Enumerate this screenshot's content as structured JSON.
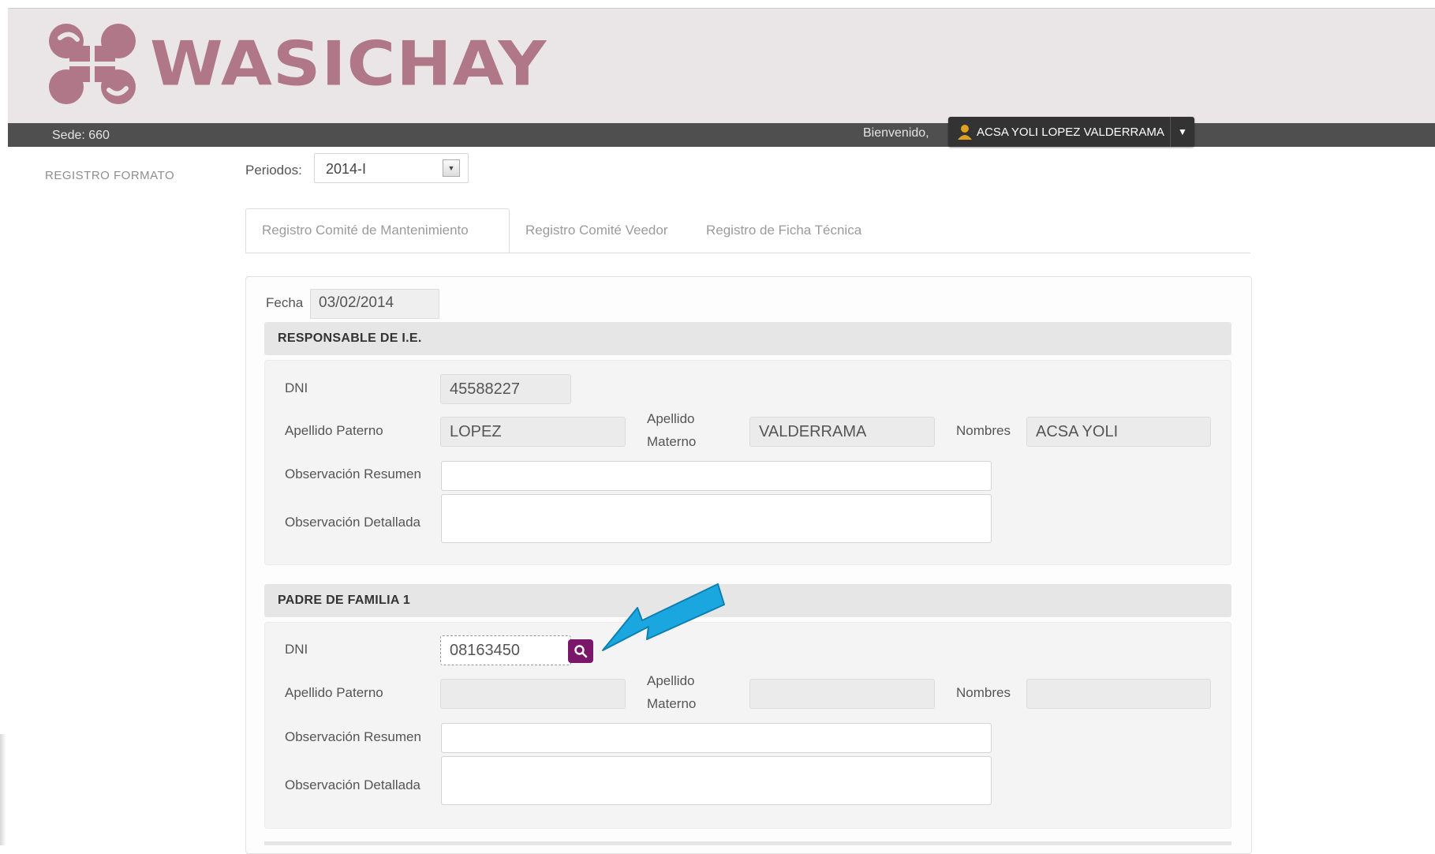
{
  "app": {
    "logo_text": "WASICHAY"
  },
  "topbar": {
    "sede": "Sede: 660",
    "bienvenido": "Bienvenido,",
    "user_name": "ACSA YOLI LOPEZ VALDERRAMA"
  },
  "sidebar": {
    "registro_formato": "REGISTRO FORMATO"
  },
  "periodos": {
    "label": "Periodos:",
    "selected": "2014-I"
  },
  "tabs": [
    {
      "label": "Registro Comité de Mantenimiento",
      "active": true
    },
    {
      "label": "Registro Comité Veedor",
      "active": false
    },
    {
      "label": "Registro de Ficha Técnica",
      "active": false
    }
  ],
  "form": {
    "fecha_label": "Fecha",
    "fecha_value": "03/02/2014",
    "sections": [
      {
        "title": "RESPONSABLE DE I.E.",
        "dni_label": "DNI",
        "dni_value": "45588227",
        "apellido_paterno_label": "Apellido Paterno",
        "apellido_paterno_value": "LOPEZ",
        "apellido_materno_label_1": "Apellido",
        "apellido_materno_label_2": "Materno",
        "apellido_materno_value": "VALDERRAMA",
        "nombres_label": "Nombres",
        "nombres_value": "ACSA YOLI",
        "obs_resumen_label": "Observación Resumen",
        "obs_resumen_value": "",
        "obs_detallada_label": "Observación Detallada",
        "obs_detallada_value": ""
      },
      {
        "title": "PADRE DE FAMILIA 1",
        "dni_label": "DNI",
        "dni_value": "08163450",
        "apellido_paterno_label": "Apellido Paterno",
        "apellido_paterno_value": "",
        "apellido_materno_label_1": "Apellido",
        "apellido_materno_label_2": "Materno",
        "apellido_materno_value": "",
        "nombres_label": "Nombres",
        "nombres_value": "",
        "obs_resumen_label": "Observación Resumen",
        "obs_resumen_value": "",
        "obs_detallada_label": "Observación Detallada",
        "obs_detallada_value": ""
      }
    ]
  },
  "icons": {
    "search": "search-icon",
    "user": "user-icon",
    "caret": "caret-down-icon",
    "arrow": "arrow-left-down-icon"
  },
  "colors": {
    "logo": "#b07788",
    "topbar": "#4f4f4f",
    "search_button": "#7a176b",
    "annotation_arrow": "#1aa7e0"
  }
}
